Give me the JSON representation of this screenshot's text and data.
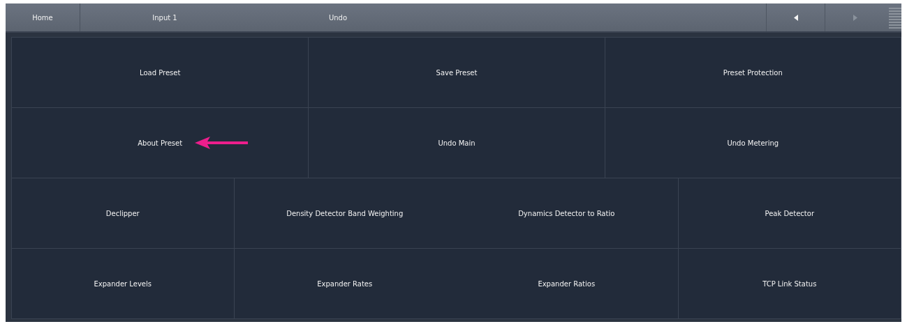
{
  "top_bar": {
    "home": "Home",
    "breadcrumbs": [
      "Input 1",
      "Undo"
    ]
  },
  "rows": [
    {
      "kind": "three",
      "buttons": [
        {
          "label": "Load Preset",
          "pointer": false
        },
        {
          "label": "Save Preset",
          "pointer": false
        },
        {
          "label": "Preset Protection",
          "pointer": false
        }
      ]
    },
    {
      "kind": "three",
      "buttons": [
        {
          "label": "About Preset",
          "pointer": true
        },
        {
          "label": "Undo Main",
          "pointer": false
        },
        {
          "label": "Undo Metering",
          "pointer": false
        }
      ]
    },
    {
      "kind": "four",
      "buttons": [
        {
          "label": "Declipper",
          "pointer": false
        },
        {
          "label": "Density Detector Band Weighting",
          "pointer": false
        },
        {
          "label": "Dynamics Detector to Ratio",
          "pointer": false
        },
        {
          "label": "Peak Detector",
          "pointer": false
        }
      ]
    },
    {
      "kind": "four",
      "buttons": [
        {
          "label": "Expander Levels",
          "pointer": false
        },
        {
          "label": "Expander Rates",
          "pointer": false
        },
        {
          "label": "Expander Ratios",
          "pointer": false
        },
        {
          "label": "TCP Link Status",
          "pointer": false
        }
      ]
    }
  ]
}
